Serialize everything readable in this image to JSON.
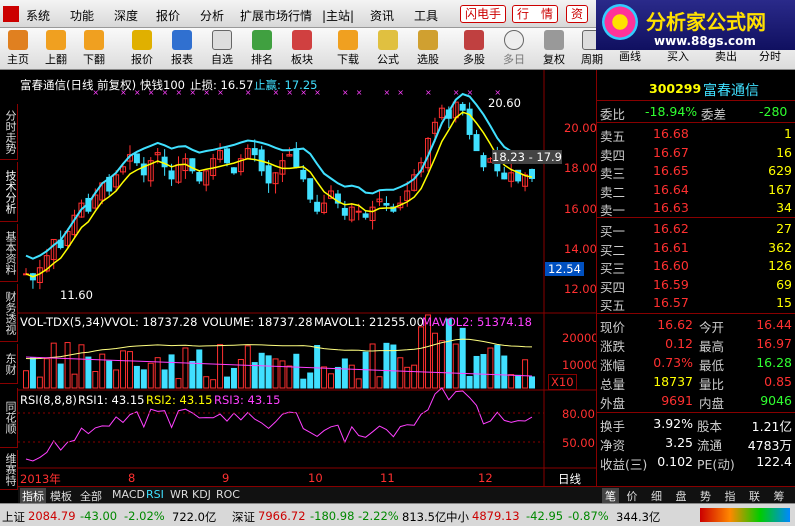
{
  "menubar": {
    "items": [
      "系统",
      "功能",
      "深度",
      "报价",
      "分析",
      "扩展市场行情",
      "|主站|",
      "资讯",
      "工具"
    ],
    "buttons": [
      "闪电手",
      "行　情",
      "资"
    ]
  },
  "brand": {
    "name": "分析家公式网",
    "url": "www.88gs.com"
  },
  "toolbar": {
    "items": [
      "主页",
      "上翻",
      "下翻",
      "报价",
      "报表",
      "自选",
      "排名",
      "板块",
      "下载",
      "公式",
      "选股",
      "多股",
      "多日",
      "复权",
      "周期",
      "画线",
      "买入",
      "卖出",
      "分时"
    ]
  },
  "sidetabs": [
    "分时走势",
    "技术分析",
    "基本资料",
    "财务透视",
    "东财",
    "同花顺",
    "维赛特"
  ],
  "chart_header": {
    "title": "富春通信(日线 前复权)",
    "name": "快钱100",
    "stop_loss_label": "止损: 16.57",
    "stop_profit_label": "止赢: 17.25"
  },
  "price_axis": [
    "20.00",
    "18.00",
    "16.00",
    "14.00",
    "12.00"
  ],
  "price_tag": "12.54",
  "annotations": {
    "high": "20.60",
    "low": "11.60",
    "range_label": "18.23 - 17.9"
  },
  "vol_header": {
    "name": "VOL-TDX(5,34)",
    "vvol": "VVOL: 18737.28",
    "volume": "VOLUME: 18737.28",
    "mavol1": "MAVOL1: 21255.00",
    "mavol2": "MAVOL2: 51374.18"
  },
  "vol_axis": [
    "20000",
    "10000"
  ],
  "vol_multiplier": "X10",
  "rsi_header": {
    "name": "RSI(8,8,8)",
    "rsi1": "RSI1: 43.15",
    "rsi2": "RSI2: 43.15",
    "rsi3": "RSI3: 43.15"
  },
  "rsi_axis": [
    "80.00",
    "50.00"
  ],
  "date_axis": [
    "2013年",
    "8",
    "9",
    "10",
    "11",
    "12"
  ],
  "period_label": "日线",
  "bottom_tabs": [
    "指标",
    "模板",
    "全部",
    "MACD",
    "RSI",
    "WR",
    "KDJ",
    "ROC"
  ],
  "quote": {
    "code": "300299",
    "name": "富春通信",
    "weibi_label": "委比",
    "weibi": "-18.94%",
    "weicha_label": "委差",
    "weicha": "-280",
    "asks": [
      {
        "label": "卖五",
        "price": "16.68",
        "vol": "1"
      },
      {
        "label": "卖四",
        "price": "16.67",
        "vol": "16"
      },
      {
        "label": "卖三",
        "price": "16.65",
        "vol": "629"
      },
      {
        "label": "卖二",
        "price": "16.64",
        "vol": "167"
      },
      {
        "label": "卖一",
        "price": "16.63",
        "vol": "34"
      }
    ],
    "bids": [
      {
        "label": "买一",
        "price": "16.62",
        "vol": "27"
      },
      {
        "label": "买二",
        "price": "16.61",
        "vol": "362"
      },
      {
        "label": "买三",
        "price": "16.60",
        "vol": "126"
      },
      {
        "label": "买四",
        "price": "16.59",
        "vol": "69"
      },
      {
        "label": "买五",
        "price": "16.57",
        "vol": "15"
      }
    ],
    "stats": [
      {
        "l1": "现价",
        "v1": "16.62",
        "l2": "今开",
        "v2": "16.44"
      },
      {
        "l1": "涨跌",
        "v1": "0.12",
        "l2": "最高",
        "v2": "16.97"
      },
      {
        "l1": "涨幅",
        "v1": "0.73%",
        "l2": "最低",
        "v2": "16.28"
      },
      {
        "l1": "总量",
        "v1": "18737",
        "l2": "量比",
        "v2": "0.85"
      },
      {
        "l1": "外盘",
        "v1": "9691",
        "l2": "内盘",
        "v2": "9046"
      }
    ],
    "stats2": [
      {
        "l1": "换手",
        "v1": "3.92%",
        "l2": "股本",
        "v2": "1.21亿"
      },
      {
        "l1": "净资",
        "v1": "3.25",
        "l2": "流通",
        "v2": "4783万"
      },
      {
        "l1": "收益(三)",
        "v1": "0.102",
        "l2": "PE(动)",
        "v2": "122.4"
      }
    ],
    "tabs": [
      "笔",
      "价",
      "细",
      "盘",
      "势",
      "指",
      "联",
      "筹"
    ]
  },
  "status": {
    "sh_label": "上证",
    "sh_value": "2084.79",
    "sh_change": "-43.00",
    "sh_pct": "-2.02%",
    "sh_amount": "722.0亿",
    "sz_label": "深证",
    "sz_value": "7966.72",
    "sz_change": "-180.98",
    "sz_pct": "-2.22%",
    "sz_amount": "813.5亿",
    "zx_label": "中小",
    "zx_value": "4879.13",
    "zx_change": "-42.95",
    "zx_pct": "-0.87%",
    "zx_amount": "344.3亿"
  },
  "colors": {
    "up": "#ff3030",
    "down": "#40e0ff",
    "ma_fast": "#ffff00",
    "band": "#40e0ff",
    "rsi": "#ff40ff"
  }
}
